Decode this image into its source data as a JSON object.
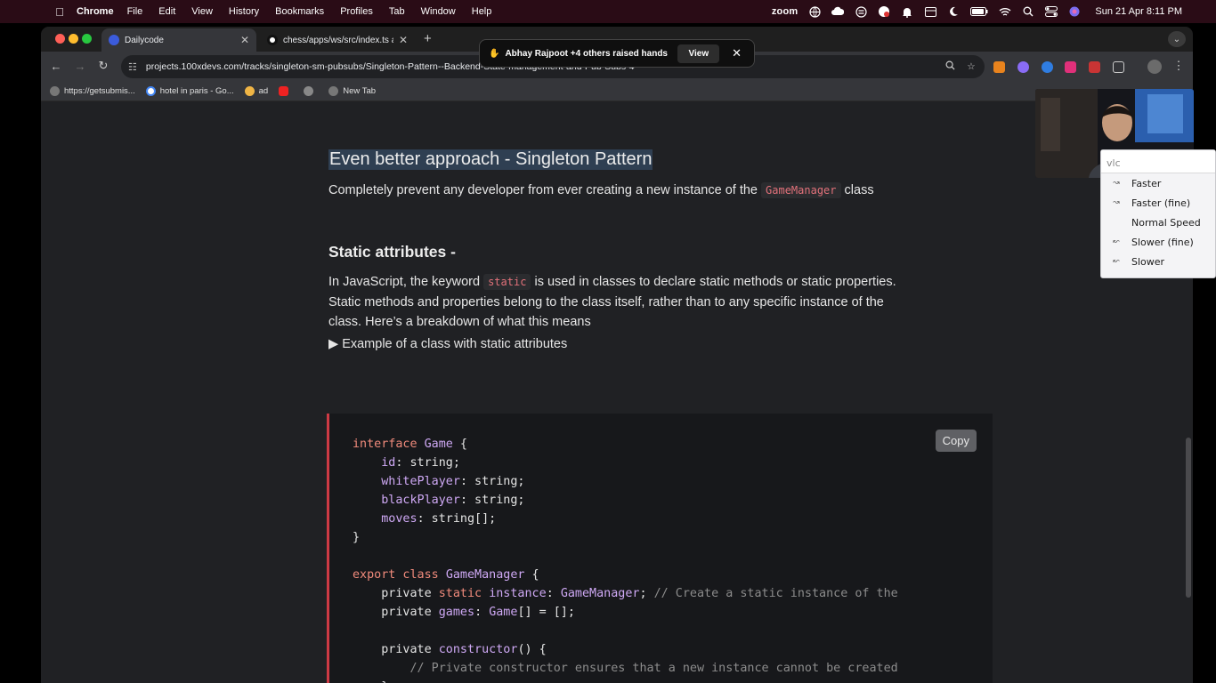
{
  "menubar": {
    "app_name": "Chrome",
    "items": [
      "File",
      "Edit",
      "View",
      "History",
      "Bookmarks",
      "Profiles",
      "Tab",
      "Window",
      "Help"
    ],
    "zoom_label": "zoom",
    "clock": "Sun 21 Apr  8:11 PM"
  },
  "tabs": [
    {
      "title": "Dailycode",
      "active": true
    },
    {
      "title": "chess/apps/ws/src/index.ts a",
      "active": false
    }
  ],
  "toast": {
    "message": "Abhay Rajpoot +4 others raised hands",
    "view_label": "View"
  },
  "omnibox": {
    "url": "projects.100xdevs.com/tracks/singleton-sm-pubsubs/Singleton-Pattern--Backend-State-management-and-Pub-Subs-4"
  },
  "bookmarks": [
    "https://getsubmis...",
    "hotel in paris - Go...",
    "ad",
    "",
    "",
    "New Tab"
  ],
  "content": {
    "heading": "Even better approach - Singleton Pattern",
    "intro_before": "Completely prevent any developer from ever creating a new instance of the ",
    "intro_code": "GameManager",
    "intro_after": " class",
    "subheading": "Static attributes -",
    "static_before": "In JavaScript, the keyword ",
    "static_code": "static",
    "static_after": " is used in classes to declare static methods or static properties. Static methods and properties belong to the class itself, rather than to any specific instance of the class. Here’s a breakdown of what this means",
    "details_summary": "Example of a class with static attributes",
    "copy_label": "Copy",
    "code": {
      "l1_kw": "interface",
      "l1_name": "Game",
      "l1_brace": " {",
      "l2_prop": "id",
      "l2_type": ": string;",
      "l3_prop": "whitePlayer",
      "l3_type": ": string;",
      "l4_prop": "blackPlayer",
      "l4_type": ": string;",
      "l5_prop": "moves",
      "l5_type": ": string[];",
      "l6": "}",
      "l8_kw": "export class",
      "l8_name": "GameManager",
      "l8_brace": " {",
      "l9_private": "private",
      "l9_static": "static",
      "l9_prop": "instance",
      "l9_type": ": ",
      "l9_class": "GameManager",
      "l9_end": "; ",
      "l9_comment": "// Create a static instance of the",
      "l10_private": "private",
      "l10_prop": "games",
      "l10_type": ": ",
      "l10_class": "Game",
      "l10_end": "[] = [];",
      "l12_private": "private",
      "l12_ctor": "constructor",
      "l12_end": "() {",
      "l13_comment": "// Private constructor ensures that a new instance cannot be created",
      "l14": "}"
    }
  },
  "vlc_menu": {
    "search_text": "vlc",
    "items": [
      "Faster",
      "Faster (fine)",
      "Normal Speed",
      "Slower (fine)",
      "Slower"
    ]
  }
}
